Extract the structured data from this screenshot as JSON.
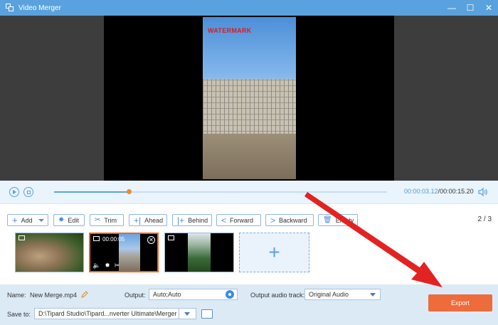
{
  "window": {
    "title": "Video Merger"
  },
  "preview": {
    "watermark_text": "WATERMARK"
  },
  "playback": {
    "current_time": "00:00:03.12",
    "separator": "/",
    "total_time": "00:00:15.20",
    "progress": 0.225
  },
  "toolbar": {
    "add": "Add",
    "edit": "Edit",
    "trim": "Trim",
    "ahead": "Ahead",
    "behind": "Behind",
    "forward": "Forward",
    "backward": "Backward",
    "empty": "Empty"
  },
  "pagination": {
    "current": "2",
    "separator": "/",
    "total": "3"
  },
  "clips": [
    {
      "duration": "",
      "selected": false
    },
    {
      "duration": "00:00:05",
      "selected": true
    },
    {
      "duration": "",
      "selected": false
    }
  ],
  "bottom": {
    "name_label": "Name:",
    "name_value": "New Merge.mp4",
    "output_label": "Output:",
    "output_value": "Auto;Auto",
    "audio_label": "Output audio track:",
    "audio_value": "Original Audio",
    "save_label": "Save to:",
    "save_value": "D:\\Tipard Studio\\Tipard...nverter Ultimate\\Merger",
    "export_label": "Export"
  },
  "colors": {
    "accent": "#5aa2de",
    "export": "#ee6b3b",
    "arrow": "#e32222"
  }
}
